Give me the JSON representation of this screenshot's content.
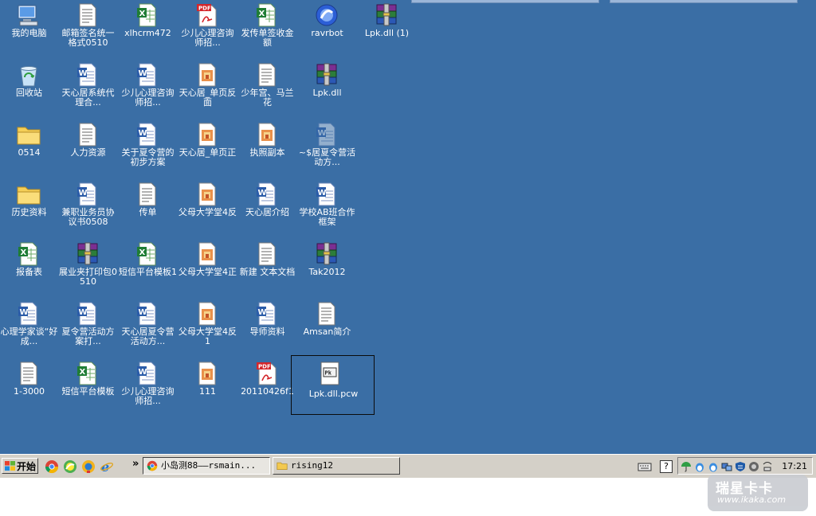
{
  "desktop": {
    "icons": [
      {
        "label": "我的电脑",
        "type": "computer"
      },
      {
        "label": "邮箱签名统一格式0510",
        "type": "txt"
      },
      {
        "label": "xlhcrm472",
        "type": "excel"
      },
      {
        "label": "少儿心理咨询师招...",
        "type": "pdf"
      },
      {
        "label": "发传单签收金额",
        "type": "excel"
      },
      {
        "label": "ravrbot",
        "type": "app"
      },
      {
        "label": "Lpk.dll (1)",
        "type": "rar"
      },
      {
        "label": "回收站",
        "type": "recycle"
      },
      {
        "label": "天心居系统代理合...",
        "type": "word"
      },
      {
        "label": "少儿心理咨询师招...",
        "type": "word"
      },
      {
        "label": "天心居_单页反面",
        "type": "image"
      },
      {
        "label": "少年宫、马兰花",
        "type": "txt"
      },
      {
        "label": "Lpk.dll",
        "type": "rar"
      },
      {
        "label": "0514",
        "type": "folder"
      },
      {
        "label": "人力资源",
        "type": "txt"
      },
      {
        "label": "关于夏令营的初步方案",
        "type": "word"
      },
      {
        "label": "天心居_单页正",
        "type": "image"
      },
      {
        "label": "执照副本",
        "type": "image"
      },
      {
        "label": "~$居夏令营活动方...",
        "type": "word-faded"
      },
      {
        "label": "历史资料",
        "type": "folder"
      },
      {
        "label": "兼职业务员协议书0508",
        "type": "word"
      },
      {
        "label": "传单",
        "type": "txt"
      },
      {
        "label": "父母大学堂4反",
        "type": "image"
      },
      {
        "label": "天心居介绍",
        "type": "word"
      },
      {
        "label": "学校AB班合作框架",
        "type": "word"
      },
      {
        "label": "报备表",
        "type": "excel"
      },
      {
        "label": "展业夹打印包0510",
        "type": "rar"
      },
      {
        "label": "短信平台模板1",
        "type": "excel"
      },
      {
        "label": "父母大学堂4正",
        "type": "image"
      },
      {
        "label": "新建 文本文档",
        "type": "txt"
      },
      {
        "label": "Tak2012",
        "type": "rar"
      },
      {
        "label": "心理学家谈“好成...",
        "type": "word"
      },
      {
        "label": "夏令营活动方案打...",
        "type": "word"
      },
      {
        "label": "天心居夏令营活动方...",
        "type": "word"
      },
      {
        "label": "父母大学堂4反1",
        "type": "image"
      },
      {
        "label": "导师资料",
        "type": "word"
      },
      {
        "label": "Amsan简介",
        "type": "txt"
      },
      {
        "label": "1-3000",
        "type": "txt"
      },
      {
        "label": "短信平台模板",
        "type": "excel"
      },
      {
        "label": "少儿心理咨询师招...",
        "type": "word"
      },
      {
        "label": "111",
        "type": "image"
      },
      {
        "label": "20110426f1",
        "type": "pdf"
      },
      {
        "label": "Lpk.dll.pcw",
        "type": "pcw"
      }
    ]
  },
  "taskbar": {
    "start_label": "开始",
    "chevron": "»",
    "windows": [
      {
        "label": "小岛测88——rsmain...",
        "icon": "chrome-icon",
        "active": true
      },
      {
        "label": "rising12",
        "icon": "folder-icon",
        "active": false
      }
    ],
    "tray_help": "?",
    "clock": "17:21"
  },
  "watermark": {
    "title": "瑞星卡卡",
    "url": "www.ikaka.com"
  },
  "colors": {
    "desktop": "#3a6ea5",
    "taskbar": "#d4d0c8"
  }
}
